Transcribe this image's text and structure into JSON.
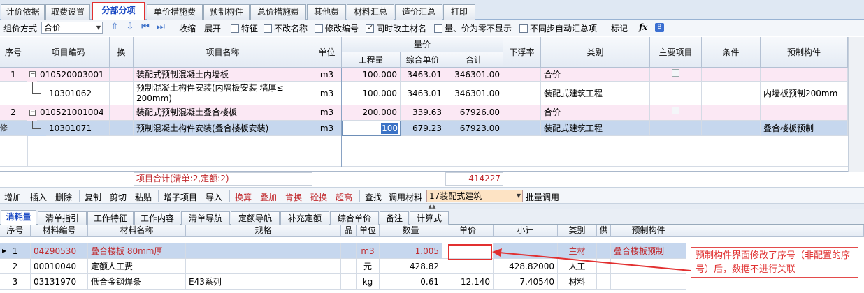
{
  "top_tabs": [
    "计价依据",
    "取费设置",
    "分部分项",
    "单价措施费",
    "预制构件",
    "总价措施费",
    "其他费",
    "材料汇总",
    "造价汇总",
    "打印"
  ],
  "active_top_tab": "分部分项",
  "toolbar1": {
    "group_label": "组价方式",
    "group_value": "合价",
    "collapse": "收缩",
    "expand": "展开",
    "checks": [
      {
        "label": "特征",
        "checked": false
      },
      {
        "label": "不改名称",
        "checked": false
      },
      {
        "label": "修改编号",
        "checked": false
      },
      {
        "label": "同时改主材名",
        "checked": true
      },
      {
        "label": "量、价为零不显示",
        "checked": false
      },
      {
        "label": "不同步自动汇总项",
        "checked": false
      }
    ],
    "mark": "标记",
    "fx": "fx",
    "b_icon": "B"
  },
  "grid": {
    "headers": {
      "seq": "序号",
      "code": "项目编码",
      "swap": "换",
      "name": "项目名称",
      "unit": "单位",
      "qty_price_group": "量价",
      "qty": "工程量",
      "unit_price": "综合单价",
      "total": "合计",
      "float_rate": "下浮率",
      "category": "类别",
      "main_item": "主要项目",
      "condition": "条件",
      "prefab": "预制构件"
    },
    "rows": [
      {
        "seq": "1",
        "code": "010520003001",
        "name": "装配式预制混凝土内墙板",
        "unit": "m3",
        "qty": "100.000",
        "unit_price": "3463.01",
        "total": "346301.00",
        "category": "合价",
        "prefab": ""
      },
      {
        "seq": "",
        "code": "10301062",
        "name": "预制混凝土构件安装(内墙板安装 墙厚≤",
        "name2": "200mm)",
        "unit": "m3",
        "qty": "100.000",
        "unit_price": "3463.01",
        "total": "346301.00",
        "category": "装配式建筑工程",
        "prefab": "内墙板预制200mm"
      },
      {
        "seq": "2",
        "code": "010521001004",
        "name": "装配式预制混凝土叠合楼板",
        "unit": "m3",
        "qty": "200.000",
        "unit_price": "339.63",
        "total": "67926.00",
        "category": "合价",
        "prefab": ""
      },
      {
        "seq": "",
        "code": "10301071",
        "name": "预制混凝土构件安装(叠合楼板安装)",
        "unit": "m3",
        "qty": "100",
        "unit_price": "679.23",
        "total": "67923.00",
        "category": "装配式建筑工程",
        "prefab": "叠合楼板预制"
      }
    ],
    "row_marker": "修",
    "summary_label": "项目合计(清单:2,定额:2)",
    "summary_total": "414227"
  },
  "toolbar2": {
    "items": [
      "增加",
      "插入",
      "删除",
      "复制",
      "剪切",
      "粘贴",
      "增子项目",
      "导入",
      "换算",
      "叠加",
      "肯换",
      "砼换",
      "超高",
      "查找",
      "调用材料"
    ],
    "red_items": [
      "换算",
      "叠加",
      "肯换",
      "砼换",
      "超高"
    ],
    "material_select": "17装配式建筑",
    "batch": "批量调用"
  },
  "bottom_tabs": [
    "消耗量",
    "清单指引",
    "工作特征",
    "工作内容",
    "清单导航",
    "定额导航",
    "补充定额",
    "综合单价",
    "备注",
    "计算式"
  ],
  "active_bottom_tab": "消耗量",
  "bottom_grid": {
    "headers": {
      "seq": "序号",
      "code": "材料编号",
      "name": "材料名称",
      "spec": "规格",
      "pin": "品",
      "unit": "单位",
      "qty": "数量",
      "price": "单价",
      "subtotal": "小计",
      "category": "类别",
      "supply": "供",
      "prefab": "预制构件"
    },
    "rows": [
      {
        "seq": "1",
        "code": "04290530",
        "name": "叠合楼板 80mm厚",
        "spec": "",
        "unit": "m3",
        "qty": "1.005",
        "price": "",
        "subtotal": "",
        "category": "主材",
        "prefab": "叠合楼板预制"
      },
      {
        "seq": "2",
        "code": "00010040",
        "name": "定额人工费",
        "spec": "",
        "unit": "元",
        "qty": "428.82",
        "price": "",
        "subtotal": "428.82000",
        "category": "人工",
        "prefab": ""
      },
      {
        "seq": "3",
        "code": "03131970",
        "name": "低合金钢焊条",
        "spec": "E43系列",
        "unit": "kg",
        "qty": "0.61",
        "price": "12.140",
        "subtotal": "7.40540",
        "category": "材料",
        "prefab": ""
      }
    ]
  },
  "annotation": "预制构件界面修改了序号（非配置的序号）后，数据不进行关联",
  "colors": {
    "accent_red": "#e23030",
    "tab_blue": "#1a49c4",
    "list_row_pink": "#fbe8f4",
    "selected_row": "#c6d7ee"
  }
}
